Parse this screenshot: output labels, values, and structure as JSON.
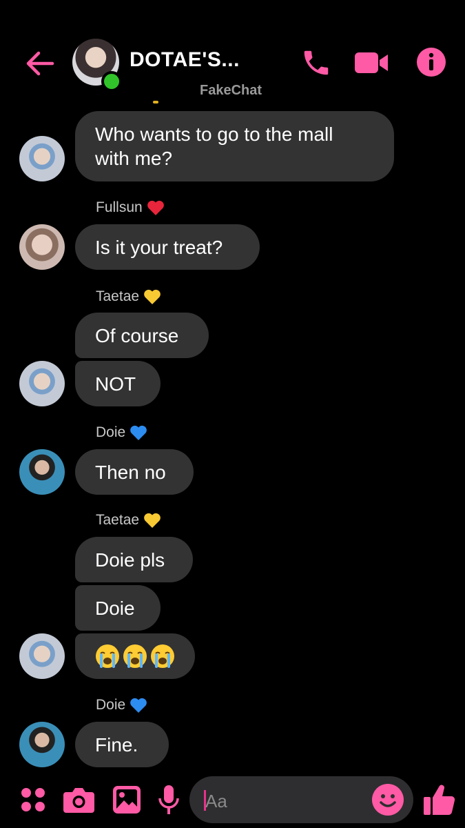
{
  "accent_color": "#ff5aa5",
  "header": {
    "title": "DOTAE'S...",
    "online": true,
    "watermark": "FakeChat",
    "back_icon": "arrow-left-icon",
    "call_icon": "phone-icon",
    "video_icon": "video-camera-icon",
    "info_icon": "info-icon"
  },
  "messages": [
    {
      "sender": "",
      "lines": [
        "Who wants to go to the mall",
        "with me?"
      ]
    },
    {
      "sender": "Fullsun",
      "heart": "red",
      "text": "Is it your treat?"
    },
    {
      "sender": "Taetae",
      "heart": "yellow",
      "text": "Of course"
    },
    {
      "sender": "",
      "text": "NOT"
    },
    {
      "sender": "Doie",
      "heart": "blue",
      "text": "Then no"
    },
    {
      "sender": "Taetae",
      "heart": "yellow",
      "text": "Doie pls"
    },
    {
      "sender": "",
      "text": "Doie"
    },
    {
      "sender": "",
      "emoji": "loudly-crying-face x3"
    },
    {
      "sender": "Doie",
      "heart": "blue",
      "text": "Fine."
    }
  ],
  "composer": {
    "placeholder": "Aa",
    "apps_icon": "four-dots-icon",
    "camera_icon": "camera-icon",
    "gallery_icon": "image-icon",
    "mic_icon": "microphone-icon",
    "emoji_icon": "smile-icon",
    "like_icon": "thumbs-up-icon"
  }
}
